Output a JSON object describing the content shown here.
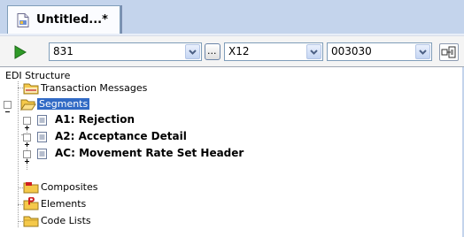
{
  "tab": {
    "title": "Untitled...*"
  },
  "toolbar": {
    "transaction_set": "831",
    "ellipsis_label": "...",
    "standard": "X12",
    "version": "003030"
  },
  "tree": {
    "root": "EDI Structure",
    "items": [
      {
        "label": "Transaction Messages"
      },
      {
        "label": "Segments"
      },
      {
        "label": "A1: Rejection"
      },
      {
        "label": "A2: Acceptance Detail"
      },
      {
        "label": "AC: Movement Rate Set Header"
      },
      {
        "label": "Composites"
      },
      {
        "label": "Elements"
      },
      {
        "label": "Code Lists"
      }
    ]
  },
  "colors": {
    "selection": "#316ac5",
    "play": "#2e9a27",
    "folder": "#f5c94a",
    "elements_marker": "#d02020"
  }
}
